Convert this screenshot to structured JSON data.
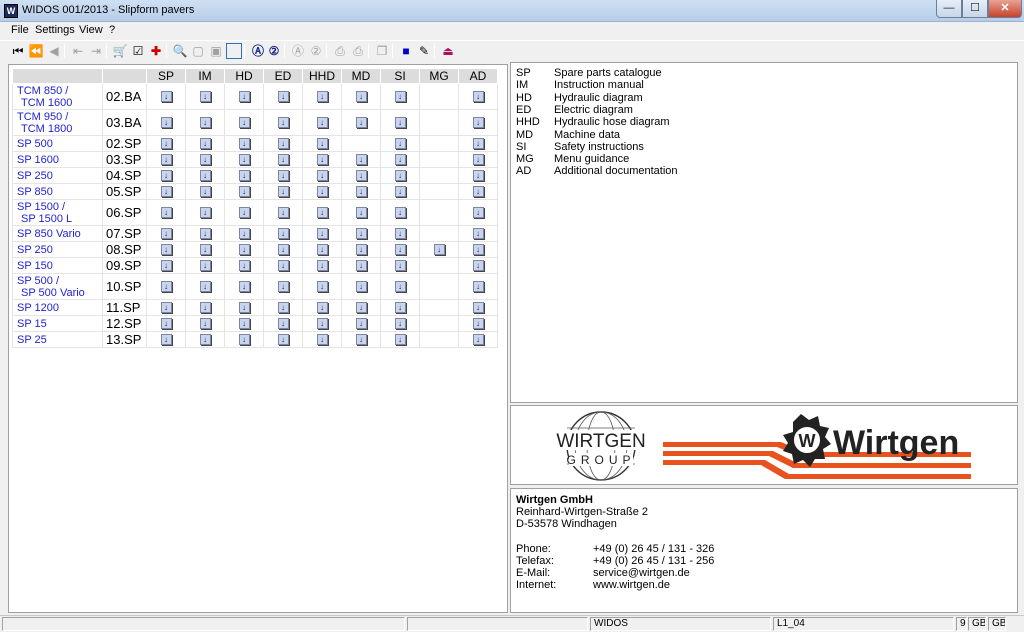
{
  "window": {
    "title": "WIDOS 001/2013 - Slipform pavers",
    "icon": "app-icon",
    "minimize": "—",
    "maximize": "☐",
    "close": "✕"
  },
  "menu": [
    "File",
    "Settings",
    "View",
    "?"
  ],
  "table": {
    "columns": [
      "SP",
      "IM",
      "HD",
      "ED",
      "HHD",
      "MD",
      "SI",
      "MG",
      "AD"
    ],
    "rows": [
      {
        "model": [
          "TCM 850 /",
          "TCM 1600"
        ],
        "code": "02.BA",
        "avail": [
          1,
          1,
          1,
          1,
          1,
          1,
          1,
          0,
          1
        ]
      },
      {
        "model": [
          "TCM 950 /",
          "TCM 1800"
        ],
        "code": "03.BA",
        "avail": [
          1,
          1,
          1,
          1,
          1,
          1,
          1,
          0,
          1
        ]
      },
      {
        "model": [
          "SP 500"
        ],
        "code": "02.SP",
        "avail": [
          1,
          1,
          1,
          1,
          1,
          0,
          1,
          0,
          1
        ]
      },
      {
        "model": [
          "SP 1600"
        ],
        "code": "03.SP",
        "avail": [
          1,
          1,
          1,
          1,
          1,
          1,
          1,
          0,
          1
        ]
      },
      {
        "model": [
          "SP 250"
        ],
        "code": "04.SP",
        "avail": [
          1,
          1,
          1,
          1,
          1,
          1,
          1,
          0,
          1
        ]
      },
      {
        "model": [
          "SP 850"
        ],
        "code": "05.SP",
        "avail": [
          1,
          1,
          1,
          1,
          1,
          1,
          1,
          0,
          1
        ]
      },
      {
        "model": [
          "SP 1500 /",
          "SP 1500 L"
        ],
        "code": "06.SP",
        "avail": [
          1,
          1,
          1,
          1,
          1,
          1,
          1,
          0,
          1
        ]
      },
      {
        "model": [
          "SP 850 Vario"
        ],
        "code": "07.SP",
        "avail": [
          1,
          1,
          1,
          1,
          1,
          1,
          1,
          0,
          1
        ]
      },
      {
        "model": [
          "SP 250"
        ],
        "code": "08.SP",
        "avail": [
          1,
          1,
          1,
          1,
          1,
          1,
          1,
          1,
          1
        ]
      },
      {
        "model": [
          "SP 150"
        ],
        "code": "09.SP",
        "avail": [
          1,
          1,
          1,
          1,
          1,
          1,
          1,
          0,
          1
        ]
      },
      {
        "model": [
          "SP 500 /",
          "SP 500 Vario"
        ],
        "code": "10.SP",
        "avail": [
          1,
          1,
          1,
          1,
          1,
          1,
          1,
          0,
          1
        ]
      },
      {
        "model": [
          "SP 1200"
        ],
        "code": "11.SP",
        "avail": [
          1,
          1,
          1,
          1,
          1,
          1,
          1,
          0,
          1
        ]
      },
      {
        "model": [
          "SP 15"
        ],
        "code": "12.SP",
        "avail": [
          1,
          1,
          1,
          1,
          1,
          1,
          1,
          0,
          1
        ]
      },
      {
        "model": [
          "SP 25"
        ],
        "code": "13.SP",
        "avail": [
          1,
          1,
          1,
          1,
          1,
          1,
          1,
          0,
          1
        ]
      }
    ],
    "download_glyph": "↓"
  },
  "legend": [
    {
      "abbr": "SP",
      "desc": "Spare parts catalogue"
    },
    {
      "abbr": "IM",
      "desc": "Instruction manual"
    },
    {
      "abbr": "HD",
      "desc": "Hydraulic diagram"
    },
    {
      "abbr": "ED",
      "desc": "Electric diagram"
    },
    {
      "abbr": "HHD",
      "desc": "Hydraulic hose diagram"
    },
    {
      "abbr": "MD",
      "desc": "Machine data"
    },
    {
      "abbr": "SI",
      "desc": "Safety instructions"
    },
    {
      "abbr": "MG",
      "desc": "Menu guidance"
    },
    {
      "abbr": "AD",
      "desc": "Additional documentation"
    }
  ],
  "logos": {
    "group_line1": "WIRTGEN",
    "group_line2": "GROUP",
    "brand": "Wirtgen",
    "emblem_letter": "W"
  },
  "contact": {
    "company": "Wirtgen GmbH",
    "street": "Reinhard-Wirtgen-Straße 2",
    "city": "D-53578 Windhagen",
    "phone_label": "Phone:",
    "phone": "+49 (0) 26 45 / 131 - 326",
    "fax_label": "Telefax:",
    "fax": "+49 (0) 26 45 / 131 - 256",
    "email_label": "E-Mail:",
    "email": "service@wirtgen.de",
    "web_label": "Internet:",
    "web": "www.wirtgen.de"
  },
  "status": {
    "app": "WIDOS",
    "level": "L1_04",
    "num": "9",
    "lang1": "GB",
    "lang2": "GB"
  },
  "colors": {
    "link_blue": "#1f1fd0",
    "wirtgen_orange": "#e8521d",
    "header_gray": "#dcdcdc"
  }
}
